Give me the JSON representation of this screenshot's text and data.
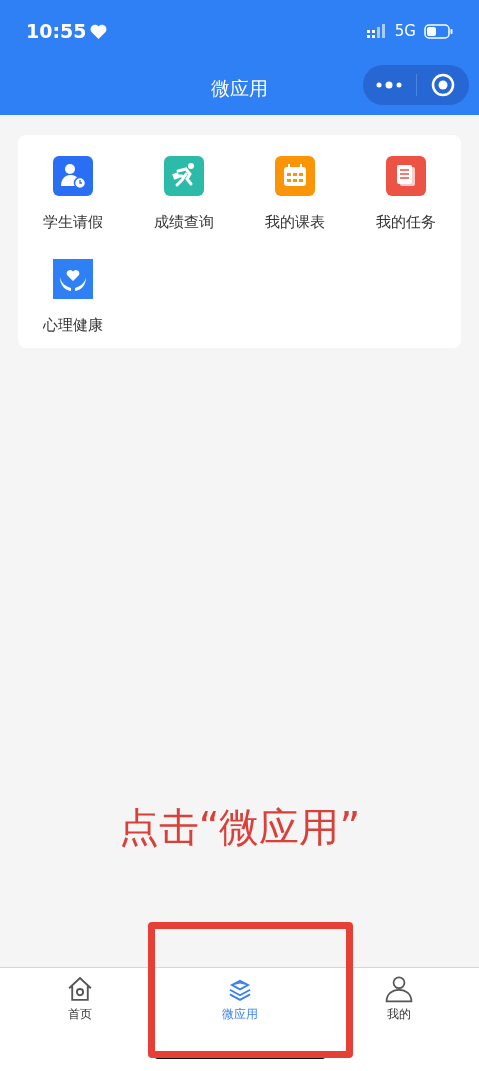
{
  "status_bar": {
    "time": "10:55",
    "network": "5G"
  },
  "header": {
    "title": "微应用"
  },
  "apps": [
    {
      "label": "学生请假",
      "color": "#2a6ff3"
    },
    {
      "label": "成绩查询",
      "color": "#2bbba8"
    },
    {
      "label": "我的课表",
      "color": "#fb9406"
    },
    {
      "label": "我的任务",
      "color": "#ec5345"
    },
    {
      "label": "心理健康",
      "color": "#2f7ff5"
    }
  ],
  "annotation": {
    "text": "点击“微应用”"
  },
  "tab_bar": [
    {
      "label": "首页",
      "selected": false
    },
    {
      "label": "微应用",
      "selected": true
    },
    {
      "label": "我的",
      "selected": false
    }
  ]
}
